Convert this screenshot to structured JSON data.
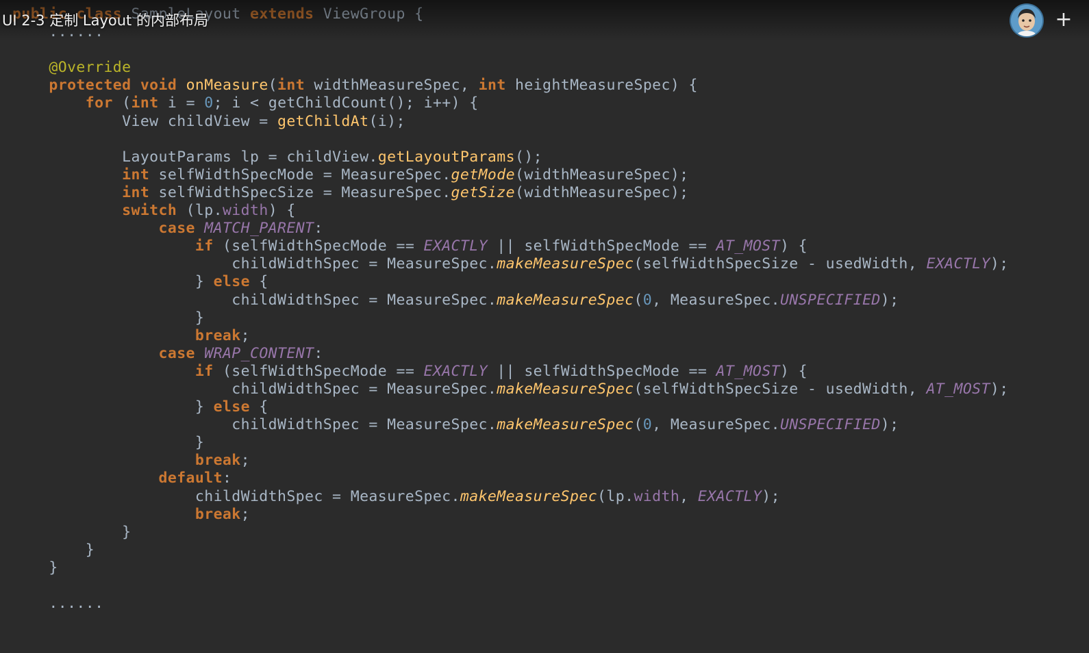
{
  "video": {
    "title": "UI 2-3 定制 Layout 的内部布局",
    "add_symbol": "+"
  },
  "colors": {
    "background": "#2b2b2b",
    "plain": "#a9b7c6",
    "keyword": "#cc7832",
    "annotation": "#bbb529",
    "method": "#ffc66d",
    "number": "#6897bb",
    "field": "#9876aa",
    "constant": "#9876aa"
  },
  "icons": {
    "avatar": "channel-avatar-icon",
    "add": "plus-icon"
  },
  "code": {
    "lines": [
      [
        [
          "kw",
          "public class "
        ],
        [
          "pl",
          "SampleLayout "
        ],
        [
          "kw",
          "extends "
        ],
        [
          "pl",
          "ViewGroup {"
        ]
      ],
      [
        [
          "pl",
          "    ......"
        ]
      ],
      [],
      [
        [
          "pl",
          "    "
        ],
        [
          "ann",
          "@Override"
        ]
      ],
      [
        [
          "pl",
          "    "
        ],
        [
          "kw",
          "protected void "
        ],
        [
          "fn",
          "onMeasure"
        ],
        [
          "pl",
          "("
        ],
        [
          "kw",
          "int "
        ],
        [
          "pl",
          "widthMeasureSpec, "
        ],
        [
          "kw",
          "int "
        ],
        [
          "pl",
          "heightMeasureSpec) {"
        ]
      ],
      [
        [
          "pl",
          "        "
        ],
        [
          "kw",
          "for "
        ],
        [
          "pl",
          "("
        ],
        [
          "kw",
          "int "
        ],
        [
          "pl",
          "i = "
        ],
        [
          "num",
          "0"
        ],
        [
          "pl",
          "; i < getChildCount(); i++) {"
        ]
      ],
      [
        [
          "pl",
          "            View childView = "
        ],
        [
          "fn",
          "getChildAt"
        ],
        [
          "pl",
          "(i);"
        ]
      ],
      [],
      [
        [
          "pl",
          "            LayoutParams lp = childView."
        ],
        [
          "fn",
          "getLayoutParams"
        ],
        [
          "pl",
          "();"
        ]
      ],
      [
        [
          "pl",
          "            "
        ],
        [
          "kw",
          "int "
        ],
        [
          "pl",
          "selfWidthSpecMode = MeasureSpec."
        ],
        [
          "st",
          "getMode"
        ],
        [
          "pl",
          "(widthMeasureSpec);"
        ]
      ],
      [
        [
          "pl",
          "            "
        ],
        [
          "kw",
          "int "
        ],
        [
          "pl",
          "selfWidthSpecSize = MeasureSpec."
        ],
        [
          "st",
          "getSize"
        ],
        [
          "pl",
          "(widthMeasureSpec);"
        ]
      ],
      [
        [
          "pl",
          "            "
        ],
        [
          "kw",
          "switch "
        ],
        [
          "pl",
          "(lp."
        ],
        [
          "fld",
          "width"
        ],
        [
          "pl",
          ") {"
        ]
      ],
      [
        [
          "pl",
          "                "
        ],
        [
          "kw",
          "case "
        ],
        [
          "con",
          "MATCH_PARENT"
        ],
        [
          "pl",
          ":"
        ]
      ],
      [
        [
          "pl",
          "                    "
        ],
        [
          "kw",
          "if "
        ],
        [
          "pl",
          "(selfWidthSpecMode == "
        ],
        [
          "con",
          "EXACTLY"
        ],
        [
          "pl",
          " || selfWidthSpecMode == "
        ],
        [
          "con",
          "AT_MOST"
        ],
        [
          "pl",
          ") {"
        ]
      ],
      [
        [
          "pl",
          "                        childWidthSpec = MeasureSpec."
        ],
        [
          "st",
          "makeMeasureSpec"
        ],
        [
          "pl",
          "(selfWidthSpecSize - usedWidth, "
        ],
        [
          "con",
          "EXACTLY"
        ],
        [
          "pl",
          ");"
        ]
      ],
      [
        [
          "pl",
          "                    } "
        ],
        [
          "kw",
          "else "
        ],
        [
          "pl",
          "{"
        ]
      ],
      [
        [
          "pl",
          "                        childWidthSpec = MeasureSpec."
        ],
        [
          "st",
          "makeMeasureSpec"
        ],
        [
          "pl",
          "("
        ],
        [
          "num",
          "0"
        ],
        [
          "pl",
          ", MeasureSpec."
        ],
        [
          "con",
          "UNSPECIFIED"
        ],
        [
          "pl",
          ");"
        ]
      ],
      [
        [
          "pl",
          "                    }"
        ]
      ],
      [
        [
          "pl",
          "                    "
        ],
        [
          "kw",
          "break"
        ],
        [
          "pl",
          ";"
        ]
      ],
      [
        [
          "pl",
          "                "
        ],
        [
          "kw",
          "case "
        ],
        [
          "con",
          "WRAP_CONTENT"
        ],
        [
          "pl",
          ":"
        ]
      ],
      [
        [
          "pl",
          "                    "
        ],
        [
          "kw",
          "if "
        ],
        [
          "pl",
          "(selfWidthSpecMode == "
        ],
        [
          "con",
          "EXACTLY"
        ],
        [
          "pl",
          " || selfWidthSpecMode == "
        ],
        [
          "con",
          "AT_MOST"
        ],
        [
          "pl",
          ") {"
        ]
      ],
      [
        [
          "pl",
          "                        childWidthSpec = MeasureSpec."
        ],
        [
          "st",
          "makeMeasureSpec"
        ],
        [
          "pl",
          "(selfWidthSpecSize - usedWidth, "
        ],
        [
          "con",
          "AT_MOST"
        ],
        [
          "pl",
          ");"
        ]
      ],
      [
        [
          "pl",
          "                    } "
        ],
        [
          "kw",
          "else "
        ],
        [
          "pl",
          "{"
        ]
      ],
      [
        [
          "pl",
          "                        childWidthSpec = MeasureSpec."
        ],
        [
          "st",
          "makeMeasureSpec"
        ],
        [
          "pl",
          "("
        ],
        [
          "num",
          "0"
        ],
        [
          "pl",
          ", MeasureSpec."
        ],
        [
          "con",
          "UNSPECIFIED"
        ],
        [
          "pl",
          ");"
        ]
      ],
      [
        [
          "pl",
          "                    }"
        ]
      ],
      [
        [
          "pl",
          "                    "
        ],
        [
          "kw",
          "break"
        ],
        [
          "pl",
          ";"
        ]
      ],
      [
        [
          "pl",
          "                "
        ],
        [
          "kw",
          "default"
        ],
        [
          "pl",
          ":"
        ]
      ],
      [
        [
          "pl",
          "                    childWidthSpec = MeasureSpec."
        ],
        [
          "st",
          "makeMeasureSpec"
        ],
        [
          "pl",
          "(lp."
        ],
        [
          "fld",
          "width"
        ],
        [
          "pl",
          ", "
        ],
        [
          "con",
          "EXACTLY"
        ],
        [
          "pl",
          ");"
        ]
      ],
      [
        [
          "pl",
          "                    "
        ],
        [
          "kw",
          "break"
        ],
        [
          "pl",
          ";"
        ]
      ],
      [
        [
          "pl",
          "            }"
        ]
      ],
      [
        [
          "pl",
          "        }"
        ]
      ],
      [
        [
          "pl",
          "    }"
        ]
      ],
      [],
      [
        [
          "pl",
          "    ......"
        ]
      ]
    ]
  }
}
